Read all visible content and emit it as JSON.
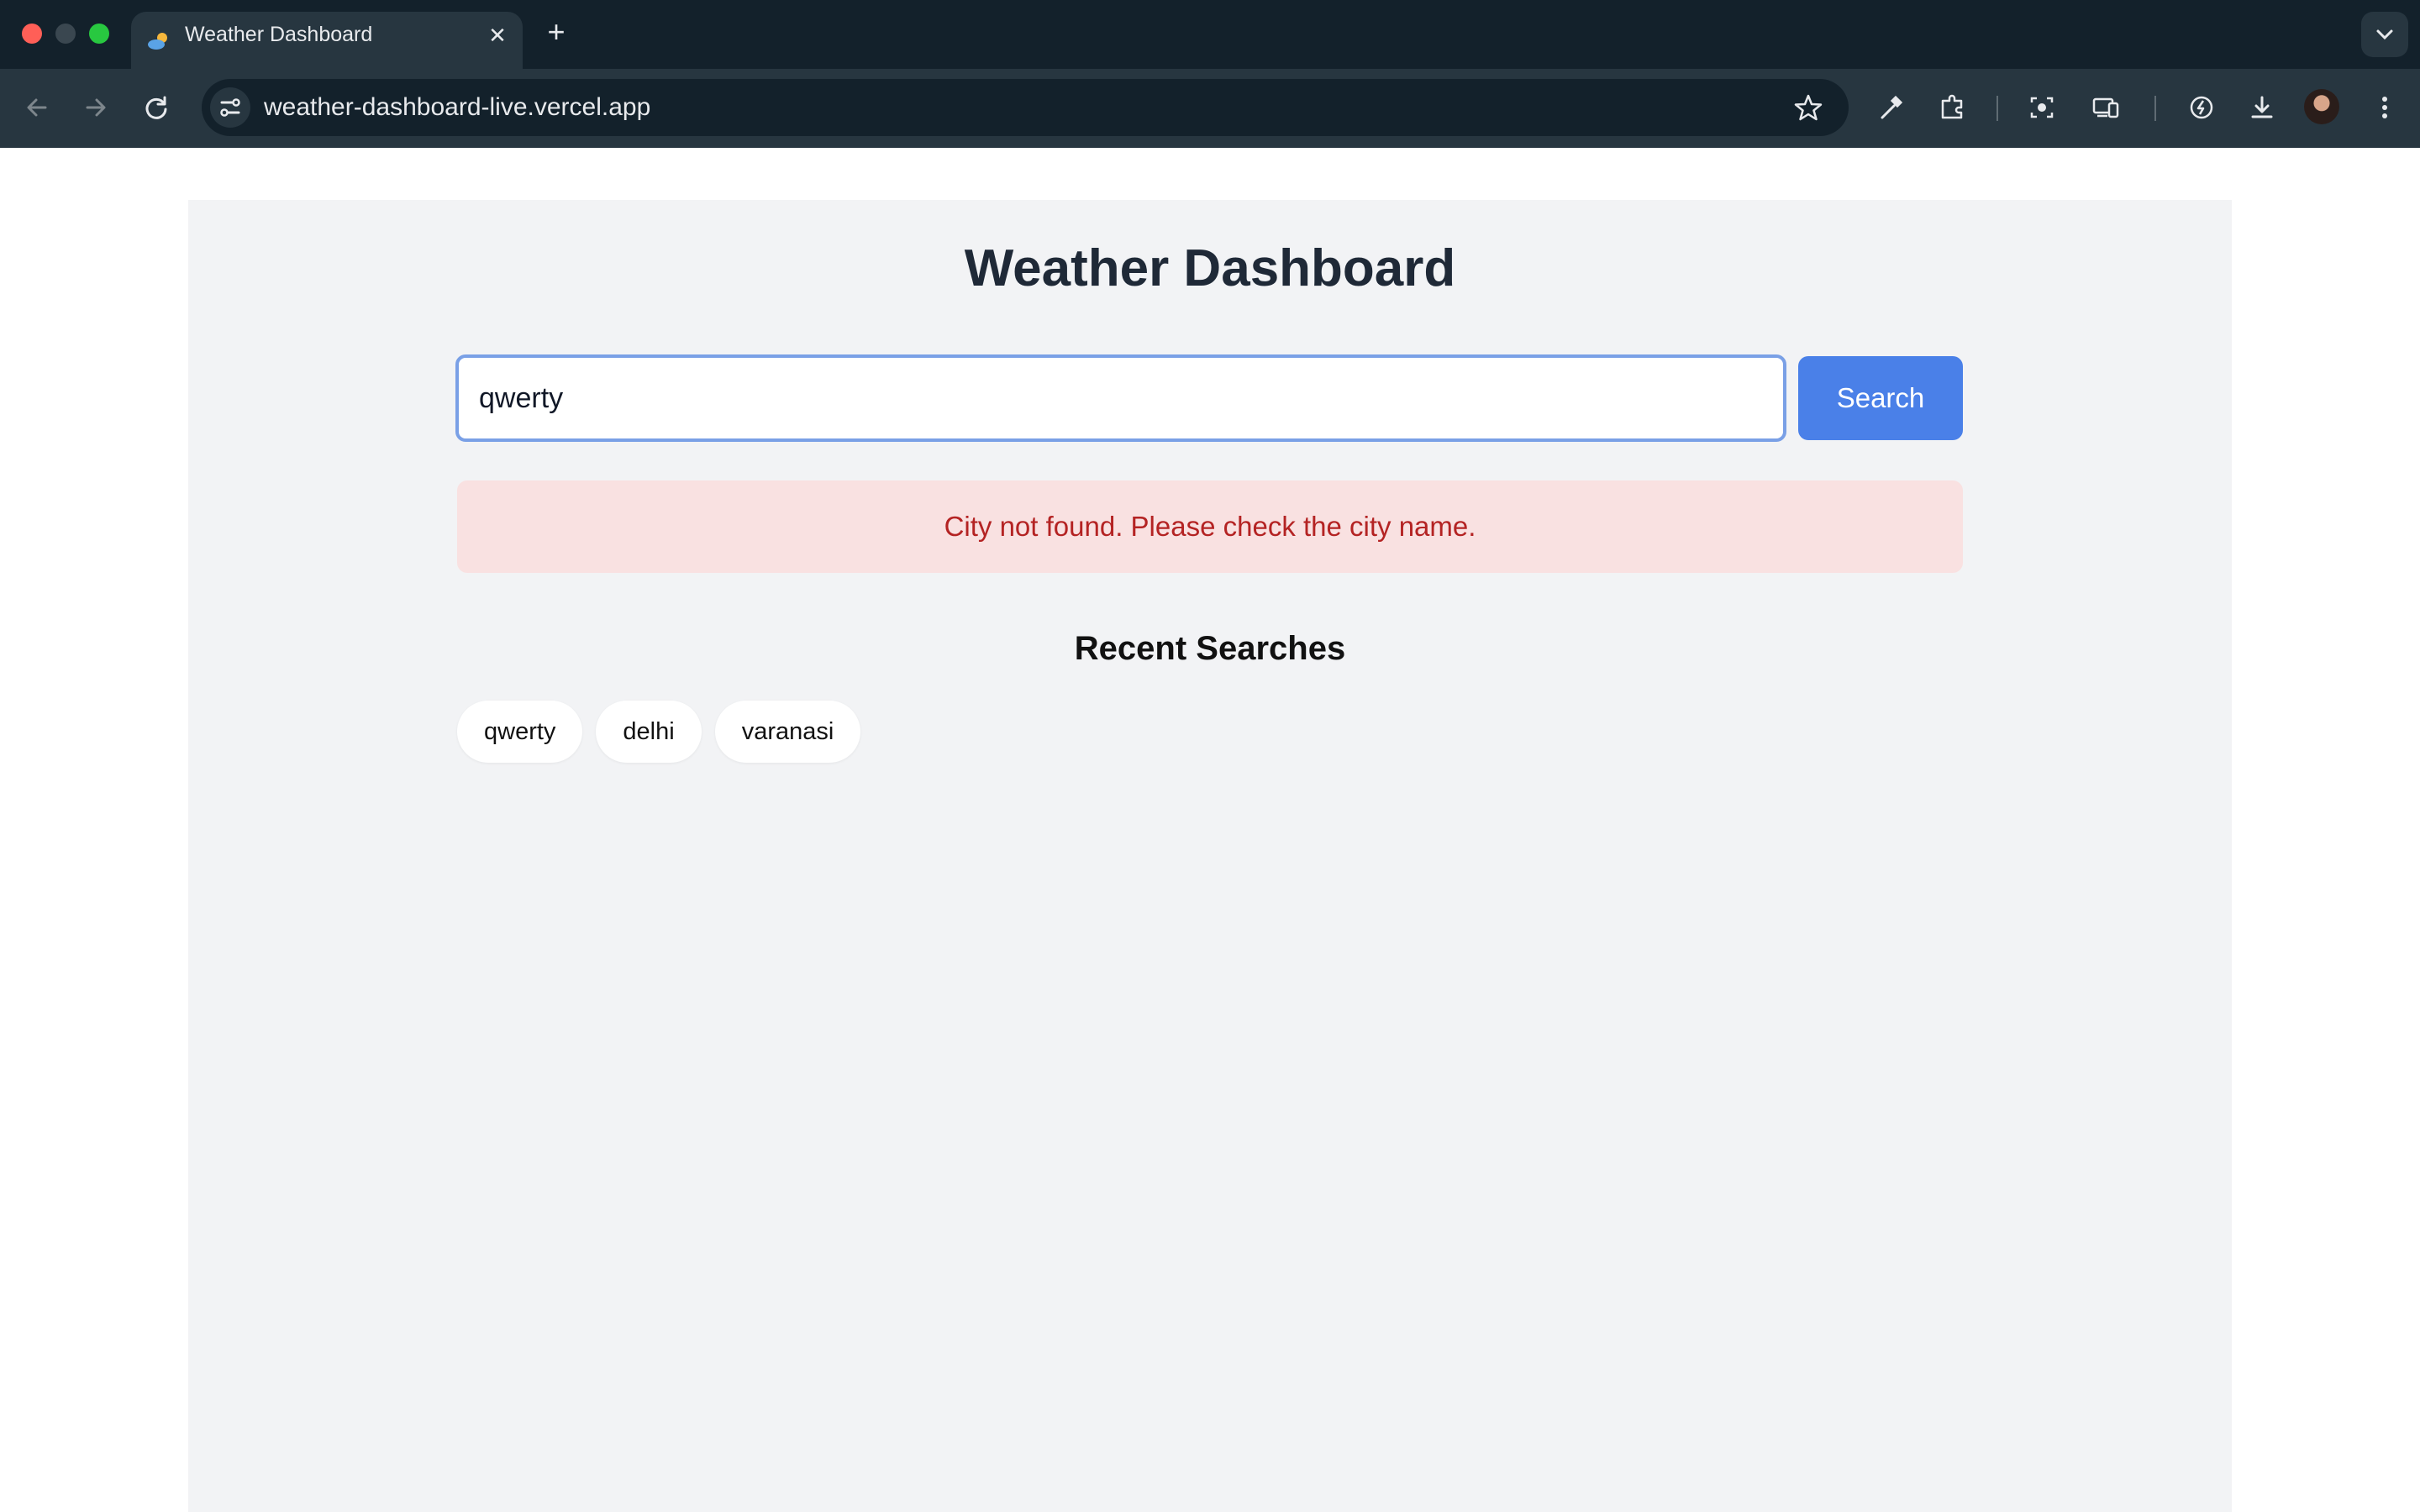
{
  "browser": {
    "tab_title": "Weather Dashboard",
    "tab_close": "✕",
    "new_tab": "+",
    "url": "weather-dashboard-live.vercel.app"
  },
  "page": {
    "title": "Weather Dashboard",
    "search": {
      "value": "qwerty",
      "button_label": "Search"
    },
    "error_message": "City not found. Please check the city name.",
    "recent_searches": {
      "title": "Recent Searches",
      "items": [
        "qwerty",
        "delhi",
        "varanasi"
      ]
    }
  },
  "colors": {
    "accent": "#4a80e8",
    "error_text": "#b42323",
    "error_bg": "#f9e1e1",
    "page_bg": "#f2f3f5"
  }
}
